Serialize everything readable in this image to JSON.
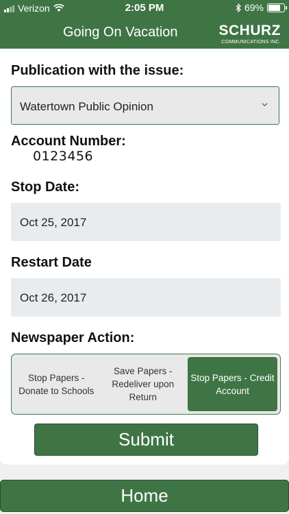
{
  "status_bar": {
    "carrier": "Verizon",
    "time": "2:05 PM",
    "battery_level": "69%",
    "battery_fraction": 0.69
  },
  "header": {
    "title": "Going On Vacation",
    "logo_name": "SCHURZ",
    "logo_sub": "COMMUNICATIONS INC."
  },
  "form": {
    "publication_label": "Publication with the issue:",
    "publication_value": "Watertown Public Opinion",
    "account_label": "Account Number:",
    "account_value": "0123456",
    "stop_label": "Stop Date:",
    "stop_value": "Oct 25, 2017",
    "restart_label": "Restart Date",
    "restart_value": "Oct 26, 2017",
    "action_label": "Newspaper Action:",
    "actions": [
      {
        "label": "Stop Papers - Donate to Schools",
        "selected": false
      },
      {
        "label": "Save Papers - Redeliver upon Return",
        "selected": false
      },
      {
        "label": "Stop Papers - Credit Account",
        "selected": true
      }
    ],
    "submit_label": "Submit"
  },
  "home_label": "Home",
  "colors": {
    "accent": "#3f7545",
    "field_bg": "#e9ecef"
  },
  "icons": [
    "signal-icon",
    "wifi-icon",
    "bluetooth-icon",
    "battery-icon",
    "chevron-down-icon"
  ]
}
